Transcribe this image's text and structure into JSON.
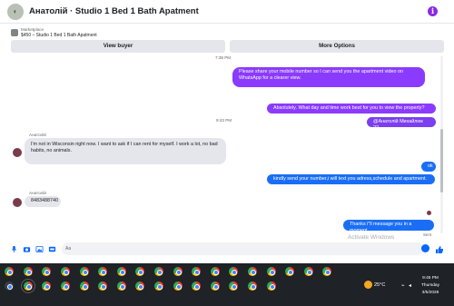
{
  "header": {
    "title": "Анатолій · Studio 1 Bed 1 Bath Apatment",
    "avatar_icon": "avatar-image",
    "info_icon": "i"
  },
  "listing": {
    "marketplace_label": "Marketplace",
    "price_title": "$450 – Studio 1 Bed 1 Bath Apatment"
  },
  "buttons": {
    "view_buyer": "View buyer",
    "more_options": "More Options"
  },
  "messages": {
    "ts1": "7:39 PM",
    "m1": "Please share your mobile number so I can send you the apartment video on WhatsApp for a clearer view.",
    "ts2": "9:43 PM",
    "m2": "Absolutely. What day and time work best for you to view the property?",
    "m3": "@Анатолій Михайлюк ??",
    "sender1": "Анатолій",
    "m4": "I'm not in Wisconsin right now. I want to ask if I can rent for myself. I work a lot, no bad habits, no animals.",
    "m5": "ok",
    "m6": "kindly send your number,i will text you adress,schedule and apartment.",
    "sender2": "Анатолій",
    "m7": "8483488740",
    "m8": "Thanks i\"ll message you in a moment",
    "sent": "Sent"
  },
  "watermark": {
    "line1": "Activate Windows",
    "line2": "Go to Settings to activate Windows."
  },
  "composer": {
    "placeholder": "Aa"
  },
  "taskbar": {
    "temperature": "25°C",
    "time": "9:45 PM",
    "day": "Thursday",
    "date": "3/5/2026"
  },
  "colors": {
    "purple": "#8a3bff",
    "blue": "#1a6ef5",
    "taskbar": "#1f2226",
    "accent": "#0866ff"
  }
}
